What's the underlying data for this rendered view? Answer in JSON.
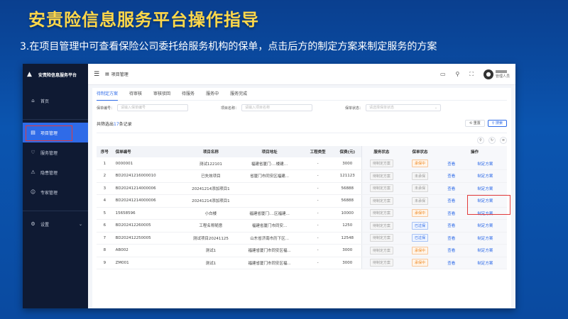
{
  "slide": {
    "title": "安责险信息服务平台操作指导",
    "subtitle": "3.在项目管理中可查看保险公司委托给服务机构的保单，点击后方的制定方案来制定服务的方案"
  },
  "app": {
    "brand": "安责险信息服务平台",
    "nav": [
      {
        "label": "首页",
        "icon": "home-icon"
      },
      {
        "label": "项目管理",
        "icon": "folder-icon",
        "active": true
      },
      {
        "label": "服务管理",
        "icon": "service-icon"
      },
      {
        "label": "隐患管理",
        "icon": "hazard-icon"
      },
      {
        "label": "专家管理",
        "icon": "expert-icon"
      },
      {
        "label": "设置",
        "icon": "settings-icon"
      }
    ],
    "breadcrumb": "项目管理",
    "user_role": "管理人员"
  },
  "tabs": [
    "待制定方案",
    "待审核",
    "审核驳回",
    "待服务",
    "服务中",
    "服务完成"
  ],
  "filters": {
    "policy_no_label": "保单编号：",
    "policy_no_placeholder": "请输入保单编号",
    "project_name_label": "项目名称：",
    "project_name_placeholder": "请输入项目名称",
    "status_label": "保单状态：",
    "status_placeholder": "请选择保单状态"
  },
  "summary": {
    "prefix": "共筛选出",
    "count": "17",
    "suffix": "条记录"
  },
  "buttons": {
    "reset": "重置",
    "search": "搜索"
  },
  "table": {
    "headers": [
      "序号",
      "保单编号",
      "项目名称",
      "项目地址",
      "工程类型",
      "保费(元)",
      "服务状态",
      "保单状态",
      "操作"
    ],
    "rows": [
      {
        "no": "1",
        "policy": "0000001",
        "name": "测试122101",
        "addr": "福建省厦门:…楼建…",
        "type": "-",
        "premium": "3000",
        "service": "待制定方案",
        "status": "承保中",
        "status_color": "orange",
        "view": "查看",
        "action": "制定方案"
      },
      {
        "no": "2",
        "policy": "BD20241216000010",
        "name": "已失效项目",
        "addr": "省厦门市同安区福建...",
        "type": "-",
        "premium": "121123",
        "service": "待制定方案",
        "status": "未承保",
        "status_color": "gray",
        "view": "查看",
        "action": "制定方案"
      },
      {
        "no": "3",
        "policy": "BD20241214000006",
        "name": "20241214添加项目1",
        "addr": "",
        "type": "-",
        "premium": "56888",
        "service": "待制定方案",
        "status": "未承保",
        "status_color": "gray",
        "view": "查看",
        "action": "制定方案"
      },
      {
        "no": "4",
        "policy": "BD20241214000006",
        "name": "20241214添加项目1",
        "addr": "",
        "type": "-",
        "premium": "56888",
        "service": "待制定方案",
        "status": "未承保",
        "status_color": "gray",
        "view": "查看",
        "action": "制定方案"
      },
      {
        "no": "5",
        "policy": "15658596",
        "name": "小白楼",
        "addr": "福建省厦门:…区福建...",
        "type": "-",
        "premium": "10000",
        "service": "待制定方案",
        "status": "承保中",
        "status_color": "orange",
        "view": "查看",
        "action": "制定方案"
      },
      {
        "no": "6",
        "policy": "BD202412260005",
        "name": "工程名称随意",
        "addr": "福建省厦门市同安...",
        "type": "-",
        "premium": "1250",
        "service": "待制定方案",
        "status": "已过保",
        "status_color": "blue",
        "view": "查看",
        "action": "制定方案"
      },
      {
        "no": "7",
        "policy": "BD202412250005",
        "name": "测试项目20241125",
        "addr": "山东省济南市历下区...",
        "type": "-",
        "premium": "12548",
        "service": "待制定方案",
        "status": "已过保",
        "status_color": "blue",
        "view": "查看",
        "action": "制定方案"
      },
      {
        "no": "8",
        "policy": "AB002",
        "name": "测试1",
        "addr": "福建省厦门市同安区福...",
        "type": "-",
        "premium": "3000",
        "service": "待制定方案",
        "status": "承保中",
        "status_color": "orange",
        "view": "查看",
        "action": "制定方案"
      },
      {
        "no": "9",
        "policy": "ZM001",
        "name": "测试1",
        "addr": "福建省厦门市同安区福...",
        "type": "-",
        "premium": "3000",
        "service": "待制定方案",
        "status": "承保中",
        "status_color": "orange",
        "view": "查看",
        "action": "制定方案"
      }
    ]
  },
  "colors": {
    "accent": "#2f6be8",
    "highlight": "#e23b3b",
    "title": "#ffd84a"
  }
}
